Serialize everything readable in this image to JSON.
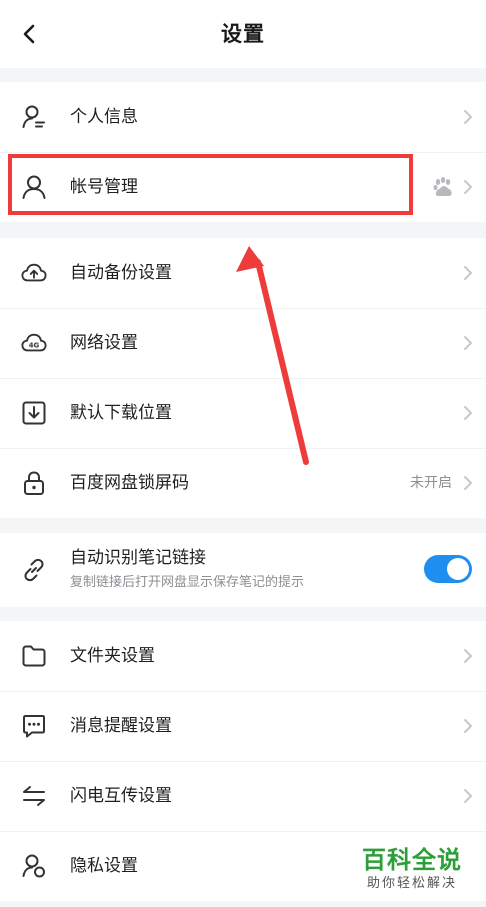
{
  "header": {
    "title": "设置"
  },
  "groups": [
    {
      "items": [
        {
          "label": "个人信息",
          "icon": "user-profile-icon"
        },
        {
          "label": "帐号管理",
          "icon": "account-icon",
          "badge": "baidu-paw-icon"
        }
      ]
    },
    {
      "items": [
        {
          "label": "自动备份设置",
          "icon": "cloud-upload-icon"
        },
        {
          "label": "网络设置",
          "icon": "cloud-4g-icon",
          "icon_text": "4G"
        },
        {
          "label": "默认下载位置",
          "icon": "download-icon"
        },
        {
          "label": "百度网盘锁屏码",
          "icon": "lock-icon",
          "value": "未开启"
        }
      ]
    },
    {
      "items": [
        {
          "label": "自动识别笔记链接",
          "sublabel": "复制链接后打开网盘显示保存笔记的提示",
          "icon": "link-icon",
          "toggle": true
        }
      ]
    },
    {
      "items": [
        {
          "label": "文件夹设置",
          "icon": "folder-icon"
        },
        {
          "label": "消息提醒设置",
          "icon": "message-icon"
        },
        {
          "label": "闪电互传设置",
          "icon": "transfer-arrows-icon"
        },
        {
          "label": "隐私设置",
          "icon": "privacy-icon"
        }
      ]
    }
  ],
  "watermark": {
    "main": "百科全说",
    "sub": "助你轻松解决"
  },
  "colors": {
    "accent": "#1f8ef1",
    "highlight": "#ee3b3b",
    "watermark": "#2e9e3a",
    "background": "#f4f5f7"
  }
}
